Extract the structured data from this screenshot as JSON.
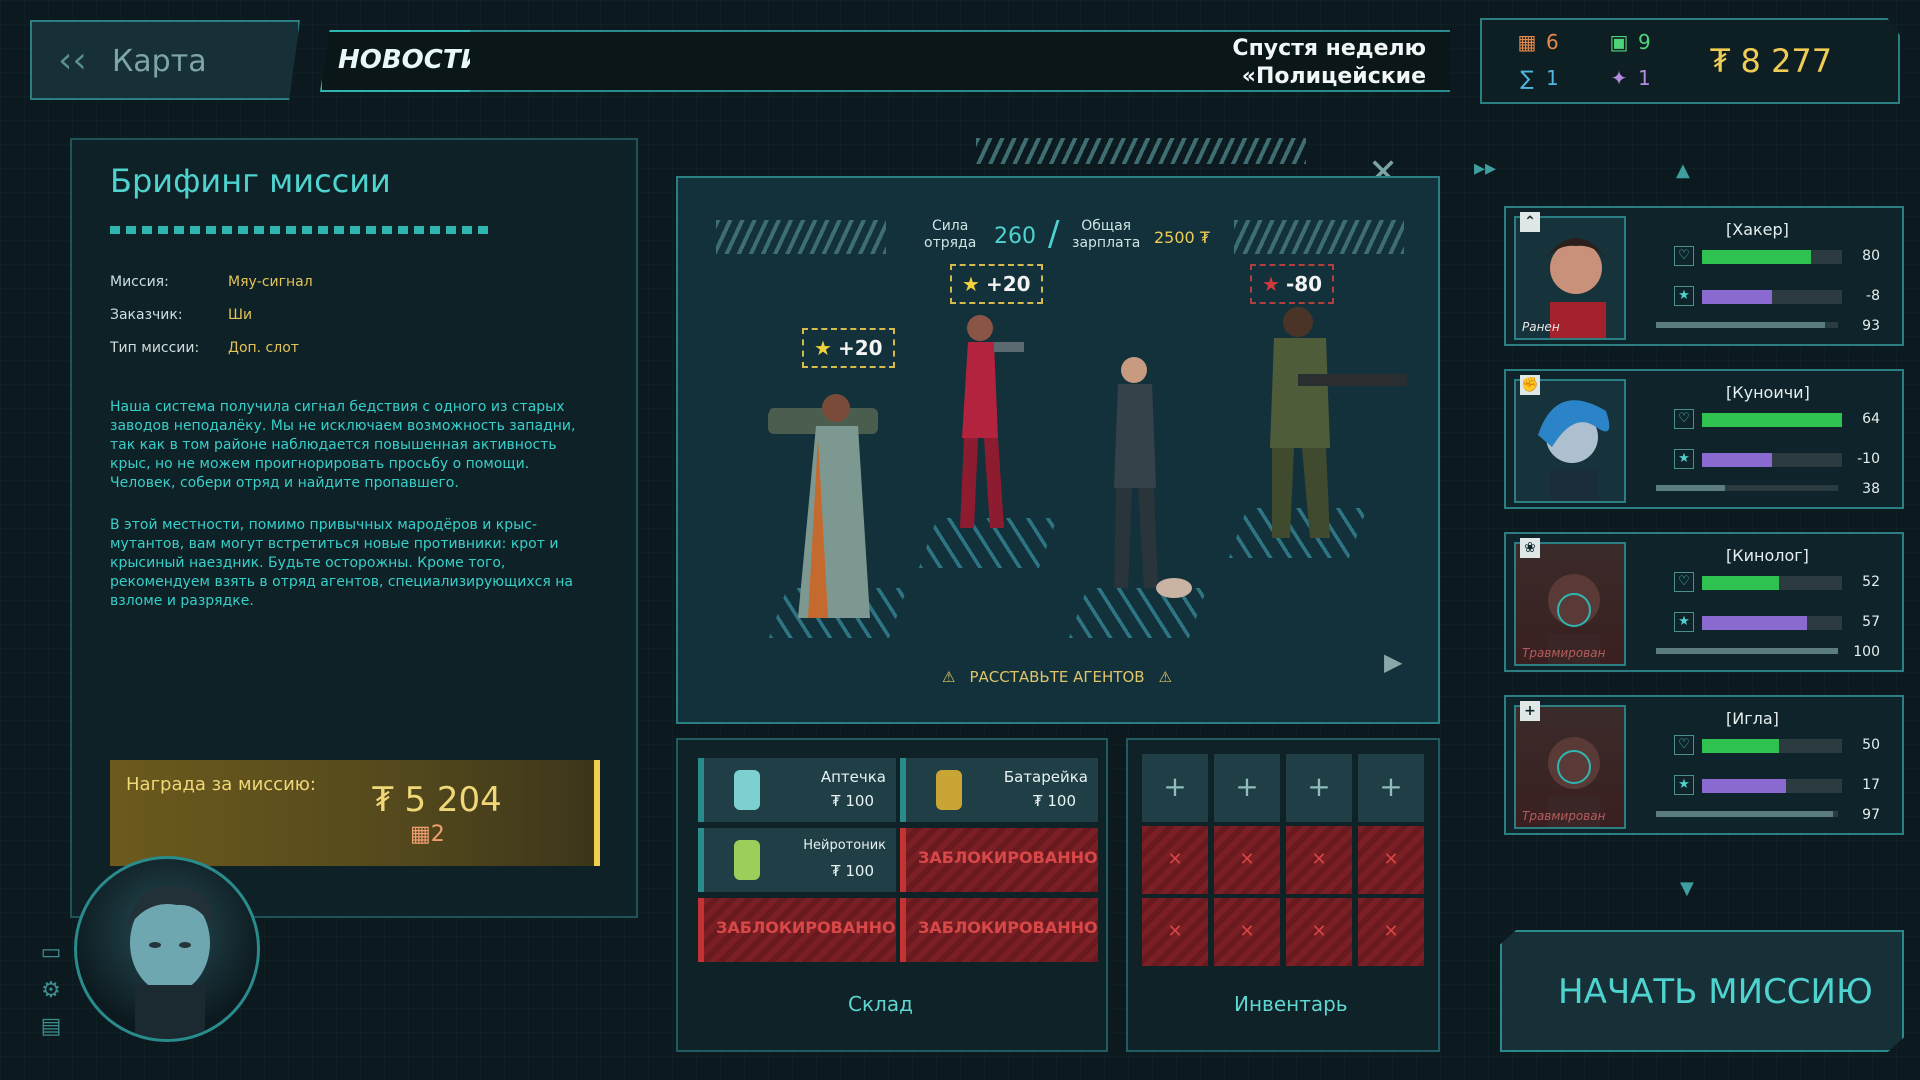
{
  "topbar": {
    "back_label": "Карта",
    "news_label": "НОВОСТИ",
    "ticker_line1": "Спустя неделю",
    "ticker_line2": "«Полицейские",
    "resources": [
      {
        "icon": "chip-icon",
        "value": "6"
      },
      {
        "icon": "camera-icon",
        "value": "9"
      },
      {
        "icon": "glyph-icon",
        "value": "1"
      },
      {
        "icon": "runner-icon",
        "value": "1"
      }
    ],
    "money": "₮ 8 277"
  },
  "briefing": {
    "title": "Брифинг миссии",
    "fields": [
      {
        "key": "Миссия:",
        "value": "Мяу-сигнал"
      },
      {
        "key": "Заказчик:",
        "value": "Ши"
      },
      {
        "key": "Тип миссии:",
        "value": "Доп. слот"
      }
    ],
    "paragraph1": "Наша система получила сигнал бедствия с одного из старых заводов неподалёку. Мы не исключаем возможность западни, так как в том районе наблюдается повышенная активность крыс, но не можем проигнорировать просьбу о помощи. Человек, собери отряд и найдите пропавшего.",
    "paragraph2": "В этой местности, помимо привычных мародёров и крыс-мутантов, вам могут встретиться новые противники: крот и крысиный наездник. Будьте осторожны. Кроме того, рекомендуем взять в отряд агентов, специализирующихся на взломе и разрядке.",
    "reward_label": "Награда за миссию:",
    "reward_money": "₮ 5 204",
    "reward_extra": "2"
  },
  "squad": {
    "strength_label_1": "Сила",
    "strength_label_2": "отряда",
    "strength_value": "260",
    "salary_label_1": "Общая",
    "salary_label_2": "зарплата",
    "salary_value": "2500 ₮",
    "badges": [
      "+20",
      "+20",
      "-80"
    ],
    "place_agents": "РАССТАВЬТЕ АГЕНТОВ"
  },
  "store": {
    "title": "Склад",
    "items": [
      {
        "name": "Аптечка",
        "price": "₮ 100"
      },
      {
        "name": "Батарейка",
        "price": "₮ 100"
      },
      {
        "name": "Нейротоник",
        "price": "₮ 100"
      }
    ],
    "locked_label": "ЗАБЛОКИРОВАННО"
  },
  "inventory": {
    "title": "Инвентарь"
  },
  "roster": [
    {
      "name": "[Хакер]",
      "status": "Ранен",
      "health": 80,
      "morale": -8,
      "xp": 93,
      "health_fill": 0.78,
      "morale_fill": 0.5
    },
    {
      "name": "[Куноичи]",
      "status": "",
      "health": 64,
      "morale": -10,
      "xp": 38,
      "health_fill": 1.0,
      "morale_fill": 0.5
    },
    {
      "name": "[Кинолог]",
      "status": "Травмирован",
      "health": 52,
      "morale": 57,
      "xp": 100,
      "health_fill": 0.55,
      "morale_fill": 0.75
    },
    {
      "name": "[Игла]",
      "status": "Травмирован",
      "health": 50,
      "morale": 17,
      "xp": 97,
      "health_fill": 0.55,
      "morale_fill": 0.6
    }
  ],
  "start_button": "НАЧАТЬ МИССИЮ",
  "colors": {
    "accent": "#4fd3cf",
    "gold": "#f0cc55",
    "danger": "#c43333"
  }
}
